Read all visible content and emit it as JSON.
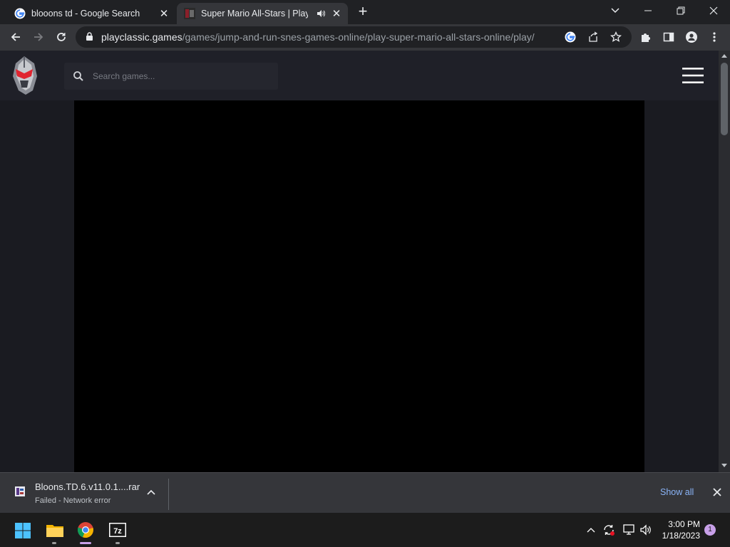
{
  "browser": {
    "tabs": [
      {
        "title": "blooons td - Google Search",
        "close": "✕"
      },
      {
        "title": "Super Mario All-Stars | Play o",
        "close": "✕"
      }
    ],
    "new_tab": "+",
    "url_host": "playclassic.games",
    "url_path": "/games/jump-and-run-snes-games-online/play-super-mario-all-stars-online/play/"
  },
  "site": {
    "search_placeholder": "Search games..."
  },
  "download": {
    "file_name": "Bloons.TD.6.v11.0.1....rar",
    "status": "Failed - Network error",
    "show_all": "Show all"
  },
  "taskbar": {
    "time": "3:00 PM",
    "date": "1/18/2023",
    "notification_count": "1"
  },
  "colors": {
    "accent_link": "#8ab4f8",
    "page_bg": "#1a1b21",
    "logo_red": "#e0242f"
  },
  "icons": [
    "google-g-icon",
    "mario-favicon-icon",
    "audio-icon",
    "back-icon",
    "forward-icon",
    "reload-icon",
    "lock-icon",
    "google-lens-icon",
    "share-icon",
    "star-icon",
    "extensions-icon",
    "side-panel-icon",
    "profile-icon",
    "menu-dots-icon",
    "search-icon",
    "hamburger-icon",
    "rar-file-icon",
    "chevron-up-icon",
    "windows-start-icon",
    "file-explorer-icon",
    "chrome-icon",
    "7zip-icon"
  ]
}
